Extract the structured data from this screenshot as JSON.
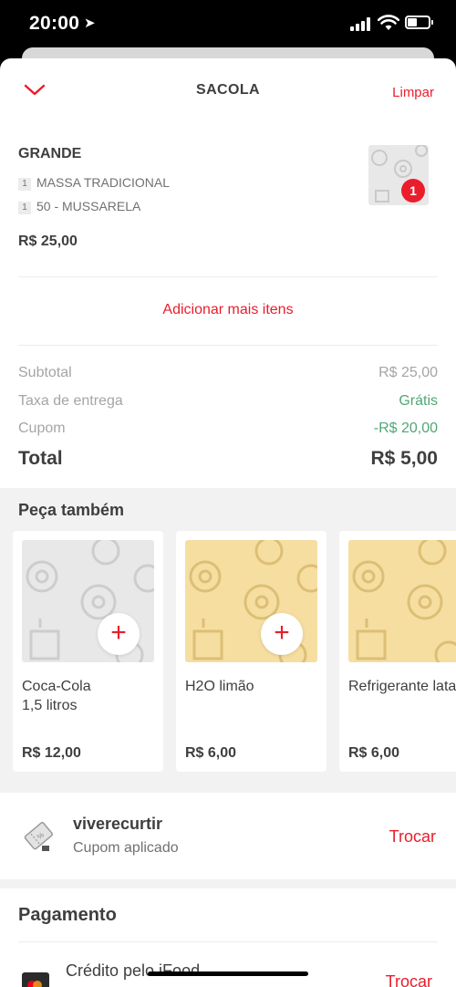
{
  "status_bar": {
    "time": "20:00"
  },
  "header": {
    "title": "SACOLA",
    "clear_label": "Limpar"
  },
  "cart_item": {
    "name": "GRANDE",
    "options": [
      {
        "qty": "1",
        "label": "MASSA TRADICIONAL"
      },
      {
        "qty": "1",
        "label": "50 - MUSSARELA"
      }
    ],
    "price": "R$ 25,00",
    "badge": "1"
  },
  "add_more_label": "Adicionar mais itens",
  "summary": {
    "subtotal_label": "Subtotal",
    "subtotal_value": "R$ 25,00",
    "delivery_label": "Taxa de entrega",
    "delivery_value": "Grátis",
    "coupon_label": "Cupom",
    "coupon_value": "-R$ 20,00",
    "total_label": "Total",
    "total_value": "R$ 5,00"
  },
  "suggestions": {
    "title": "Peça também",
    "items": [
      {
        "name_line1": "Coca-Cola",
        "name_line2": "1,5 litros",
        "price": "R$ 12,00"
      },
      {
        "name_line1": "H2O limão",
        "name_line2": "",
        "price": "R$ 6,00"
      },
      {
        "name_line1": "Refrigerante lata",
        "name_line2": "",
        "price": "R$ 6,00"
      }
    ]
  },
  "coupon": {
    "code": "viverecurtir",
    "status": "Cupom aplicado",
    "change_label": "Trocar"
  },
  "payment": {
    "title": "Pagamento",
    "method": "Crédito pelo iFood",
    "change_label": "Trocar"
  },
  "colors": {
    "accent": "#ea1d2c",
    "success": "#50a773",
    "text": "#3f3e3e",
    "muted": "#a6a5a5"
  }
}
